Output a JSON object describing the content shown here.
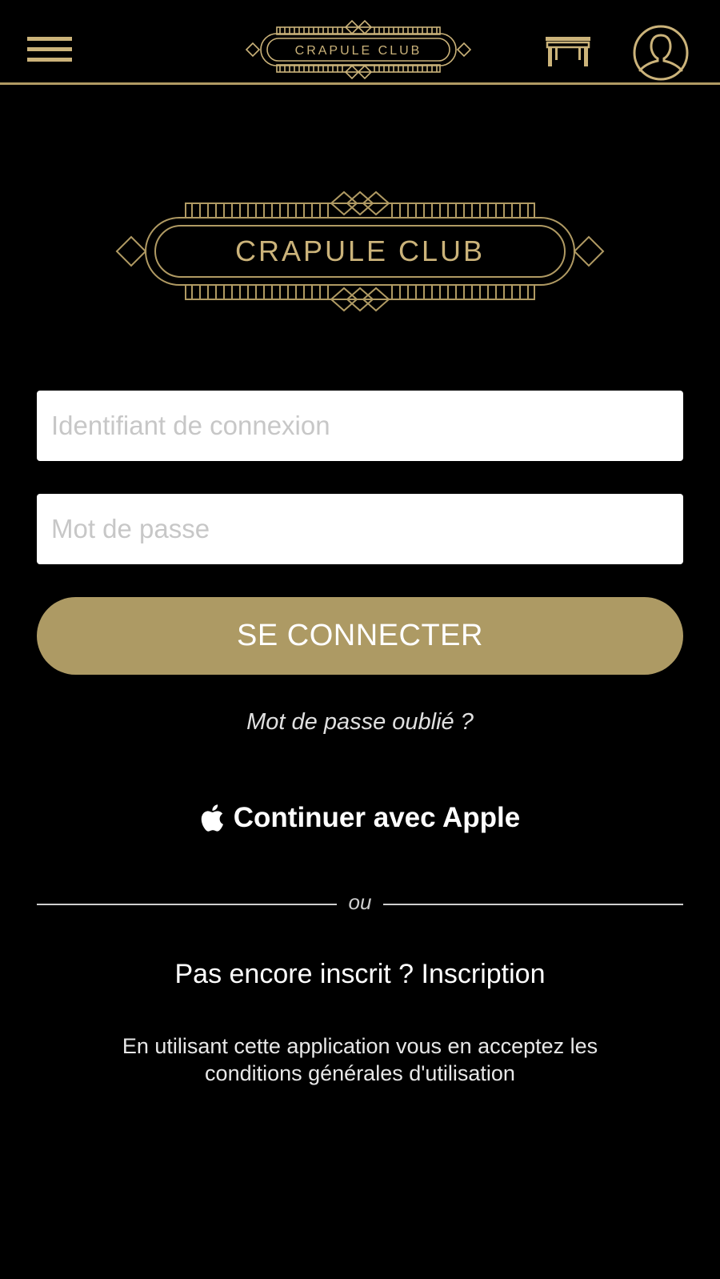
{
  "header": {
    "logo_text": "CRAPULE CLUB",
    "menu_icon": "hamburger-icon",
    "table_icon": "table-icon",
    "profile_icon": "user-profile-icon"
  },
  "hero": {
    "logo_text": "CRAPULE CLUB"
  },
  "form": {
    "login_placeholder": "Identifiant de connexion",
    "password_placeholder": "Mot de passe",
    "submit_label": "SE CONNECTER",
    "forgot_label": "Mot de passe oublié ?"
  },
  "apple": {
    "icon": "apple-logo-icon",
    "label": "Continuer avec Apple"
  },
  "divider": {
    "text": "ou"
  },
  "signup": {
    "prompt": "Pas encore inscrit ?",
    "link_label": "Inscription"
  },
  "terms": {
    "line1": "En utilisant cette application vous en acceptez les",
    "line2": "conditions générales d'utilisation"
  },
  "colors": {
    "background": "#000000",
    "accent_gold": "#ad9a64",
    "logo_gold": "#cbb37a",
    "field_background": "#ffffff"
  }
}
